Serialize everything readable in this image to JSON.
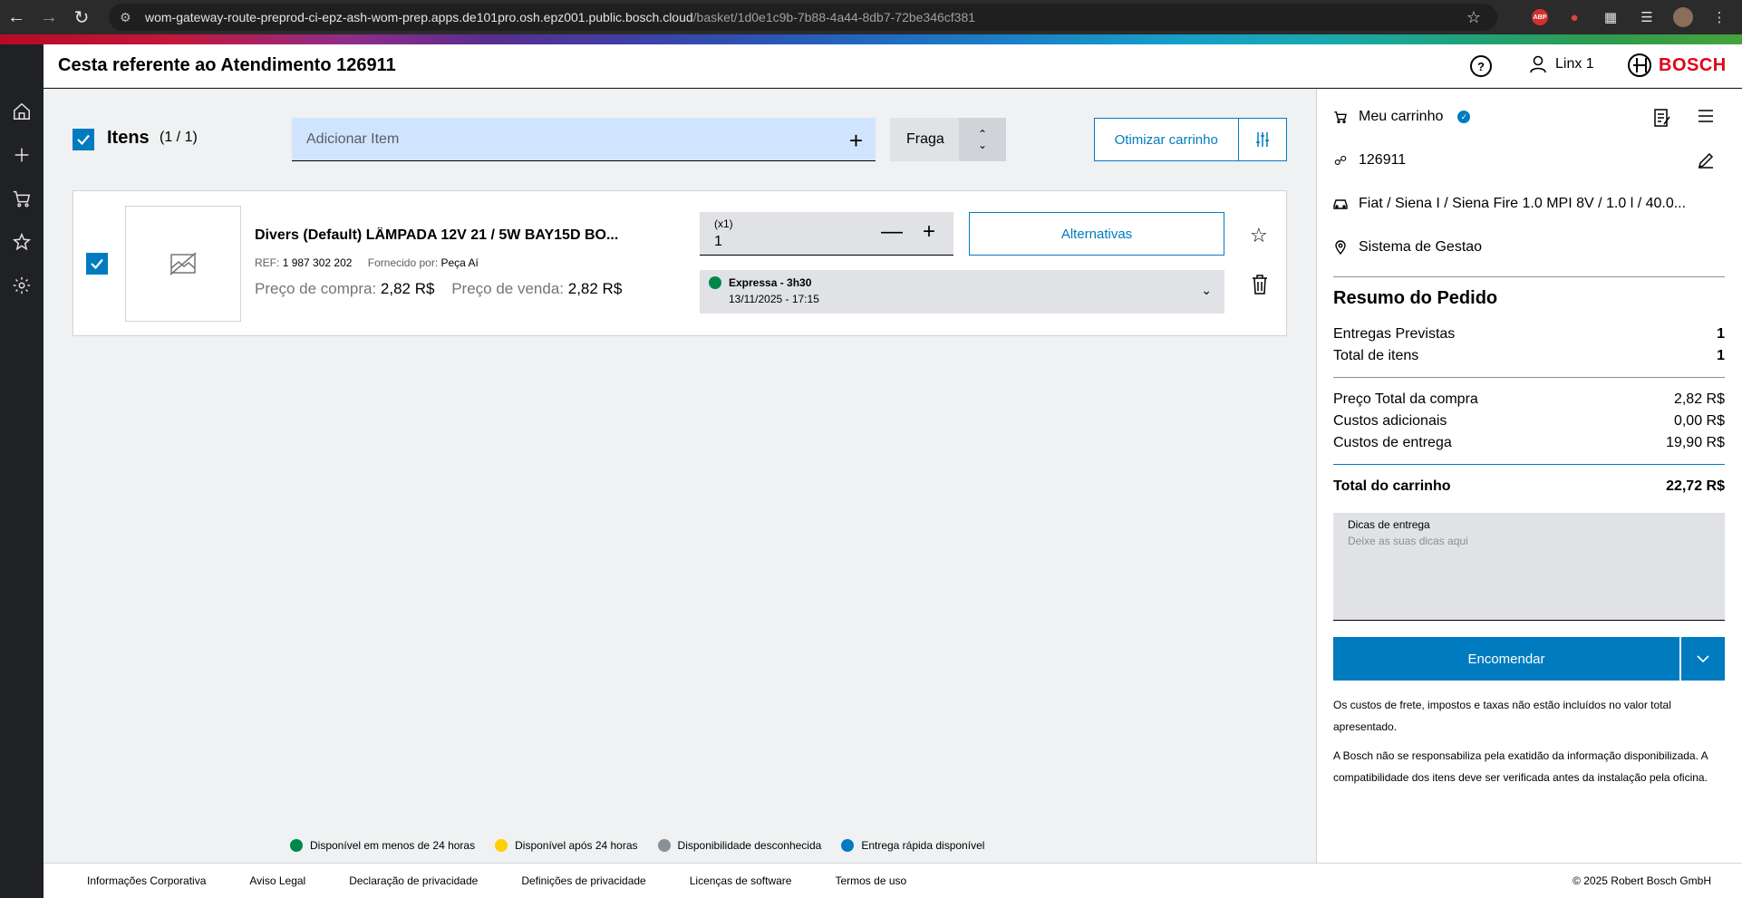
{
  "browser": {
    "url_host": "wom-gateway-route-preprod-ci-epz-ash-wom-prep.apps.de101pro.osh.epz001.public.bosch.cloud",
    "url_path": "/basket/1d0e1c9b-7b88-4a44-8db7-72be346cf381",
    "abp_label": "ABP"
  },
  "header": {
    "title": "Cesta referente ao Atendimento 126911",
    "help": "?",
    "user": "Linx 1",
    "brand": "BOSCH"
  },
  "toolbar": {
    "items_label": "Itens",
    "items_count": "(1 / 1)",
    "add_item_placeholder": "Adicionar Item",
    "brand_value": "Fraga",
    "optimize_label": "Otimizar carrinho"
  },
  "item": {
    "name": "Divers (Default) LÂMPADA 12V 21 / 5W BAY15D BO...",
    "ref_label": "REF:",
    "ref_value": "1 987 302 202",
    "supplier_label": "Fornecido por:",
    "supplier_value": "Peça Aí",
    "buy_label": "Preço de compra:",
    "buy_value": "2,82 R$",
    "sell_label": "Preço de venda:",
    "sell_value": "2,82 R$",
    "qty_multiplier": "(x1)",
    "qty_value": "1",
    "alternatives_label": "Alternativas",
    "delivery_title": "Expressa - 3h30",
    "delivery_date": "13/11/2025 - 17:15",
    "delivery_status_color": "#00884a"
  },
  "legend": [
    {
      "label": "Disponível em menos de 24 horas",
      "color": "#00884a"
    },
    {
      "label": "Disponível após 24 horas",
      "color": "#ffcf00"
    },
    {
      "label": "Disponibilidade desconhecida",
      "color": "#8a9097"
    },
    {
      "label": "Entrega rápida disponível",
      "color": "#007bc0"
    }
  ],
  "cart": {
    "title": "Meu carrinho",
    "service_id": "126911",
    "vehicle": "Fiat / Siena I / Siena Fire 1.0 MPI 8V / 1.0 l / 40.0...",
    "system": "Sistema de Gestao",
    "summary_title": "Resumo do Pedido",
    "rows_a": [
      {
        "label": "Entregas Previstas",
        "value": "1"
      },
      {
        "label": "Total de itens",
        "value": "1"
      }
    ],
    "rows_b": [
      {
        "label": "Preço Total da compra",
        "value": "2,82 R$"
      },
      {
        "label": "Custos adicionais",
        "value": "0,00 R$"
      },
      {
        "label": "Custos de entrega",
        "value": "19,90 R$"
      }
    ],
    "total_label": "Total do carrinho",
    "total_value": "22,72 R$",
    "tips_label": "Dicas de entrega",
    "tips_placeholder": "Deixe as suas dicas aqui",
    "order_label": "Encomendar",
    "disclaimer_1": "Os custos de frete, impostos e taxas não estão incluídos no valor total apresentado.",
    "disclaimer_2": "A Bosch não se responsabiliza pela exatidão da informação disponibilizada. A compatibilidade dos itens deve ser verificada antes da instalação pela oficina."
  },
  "footer": {
    "links": [
      "Informações Corporativa",
      "Aviso Legal",
      "Declaração de privacidade",
      "Definições de privacidade",
      "Licenças de software",
      "Termos de uso"
    ],
    "copyright": "© 2025 Robert Bosch GmbH"
  },
  "colors": {
    "accent": "#007bc0",
    "brand_red": "#e20015",
    "add_item_bg": "#d1e4ff"
  }
}
